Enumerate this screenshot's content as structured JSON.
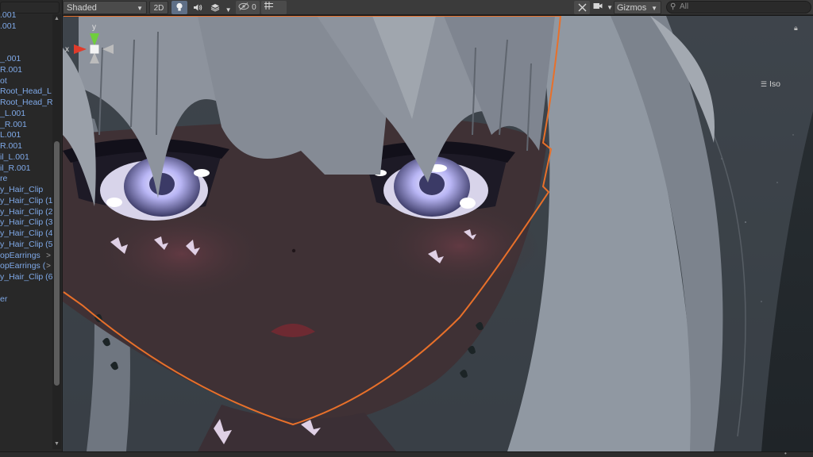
{
  "hierarchy": {
    "items": [
      {
        "label": ".001"
      },
      {
        "label": ".001"
      },
      {
        "label": ""
      },
      {
        "label": ""
      },
      {
        "label": "_.001"
      },
      {
        "label": "R.001"
      },
      {
        "label": "ot"
      },
      {
        "label": "Root_Head_L"
      },
      {
        "label": "Root_Head_R"
      },
      {
        "label": "_L.001"
      },
      {
        "label": "_R.001"
      },
      {
        "label": "L.001"
      },
      {
        "label": "R.001"
      },
      {
        "label": "il_L.001"
      },
      {
        "label": "il_R.001"
      },
      {
        "label": "re"
      },
      {
        "label": "y_Hair_Clip"
      },
      {
        "label": "y_Hair_Clip (1)"
      },
      {
        "label": "y_Hair_Clip (2"
      },
      {
        "label": "y_Hair_Clip (3"
      },
      {
        "label": "y_Hair_Clip (4"
      },
      {
        "label": "y_Hair_Clip (5"
      },
      {
        "label": "opEarrings",
        "chevron": ">"
      },
      {
        "label": "opEarrings (",
        "chevron": ">"
      },
      {
        "label": "y_Hair_Clip (6"
      },
      {
        "label": ""
      },
      {
        "label": "er"
      }
    ]
  },
  "toolbar": {
    "shading_mode": "Shaded",
    "mode_2d_label": "2D",
    "hidden_count": "0",
    "gizmos_label": "Gizmos",
    "search_placeholder": "All"
  },
  "viewport": {
    "projection_label": "Iso",
    "axes": {
      "x": "x",
      "y": "y"
    },
    "colors": {
      "selection_outline": "#e8702a",
      "background": "#262c31",
      "hair": "#8d939d",
      "skin": "#3f3135",
      "iris": "#b9b6f5"
    }
  },
  "icons": {
    "light": "lightbulb-icon",
    "audio": "speaker-icon",
    "effects": "layers-icon",
    "hidden": "eye-slash-icon",
    "grid": "grid-icon",
    "tools": "tools-icon",
    "camera": "camera-icon",
    "search": "search-icon",
    "lock": "lock-icon"
  }
}
